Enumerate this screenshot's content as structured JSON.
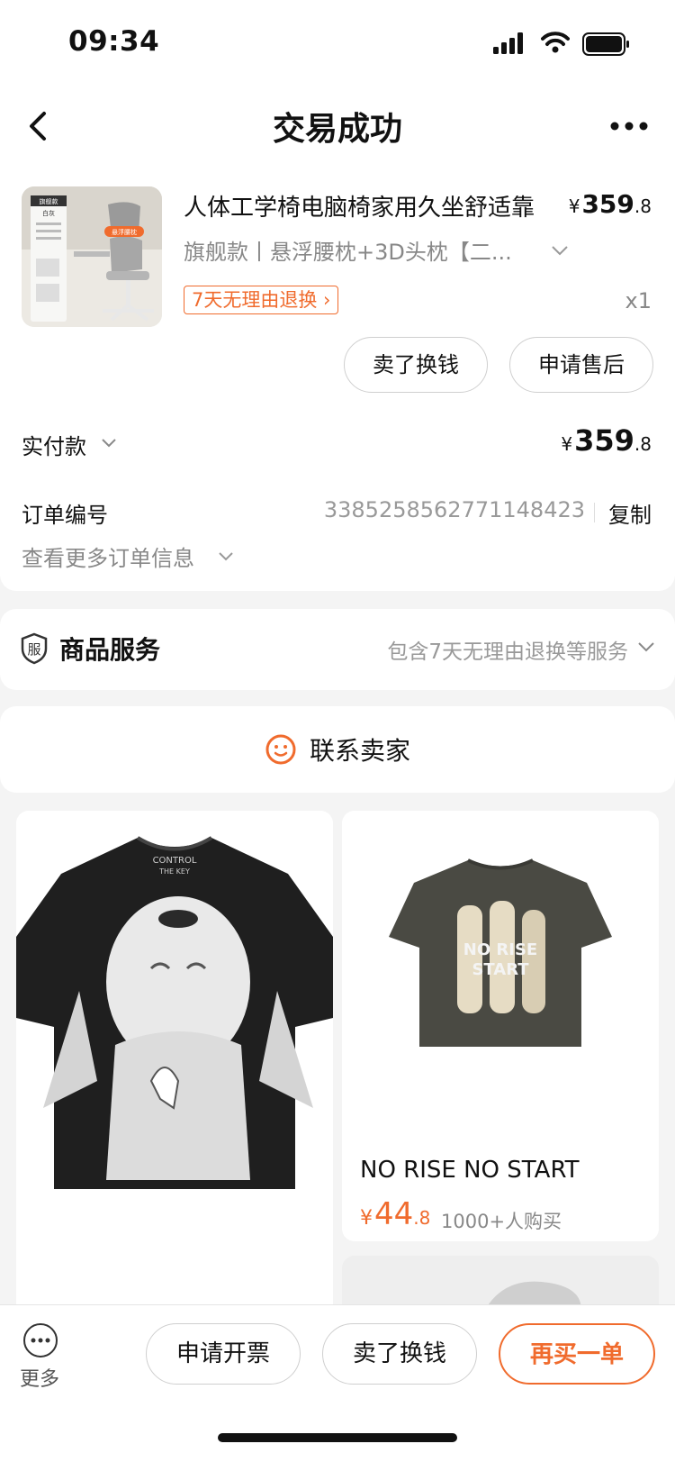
{
  "status_bar": {
    "time": "09:34"
  },
  "nav": {
    "title": "交易成功"
  },
  "order_item": {
    "name": "人体工学椅电脑椅家用久坐舒适靠",
    "price_int": "359",
    "price_dec": ".8",
    "currency": "¥",
    "spec": "旗舰款丨悬浮腰枕+3D头枕【二...",
    "tag": "7天无理由退换 ›",
    "qty": "x1",
    "thumb_texts": [
      "旗舰款",
      "白灰",
      "悬浮腰枕"
    ]
  },
  "actions": {
    "sell": "卖了换钱",
    "after_sale": "申请售后"
  },
  "payment": {
    "label": "实付款",
    "price_int": "359",
    "price_dec": ".8"
  },
  "order": {
    "label": "订单编号",
    "number": "3385258562771148423",
    "copy": "复制",
    "more_info": "查看更多订单信息"
  },
  "service": {
    "icon_char": "服",
    "title": "商品服务",
    "desc": "包含7天无理由退换等服务"
  },
  "contact": {
    "label": "联系卖家"
  },
  "recommend": {
    "left": {
      "shirt_text": [
        "CONTROL",
        "THE KEY"
      ]
    },
    "right": {
      "title": "NO RISE NO START",
      "price_int": "44",
      "price_dec": ".8",
      "sold": "1000+人购买",
      "shirt_text": [
        "NO RISE",
        "START"
      ]
    }
  },
  "bottom_bar": {
    "more": "更多",
    "invoice": "申请开票",
    "sell": "卖了换钱",
    "rebuy": "再买一单"
  },
  "colors": {
    "accent": "#f06b2d",
    "muted": "#888888"
  }
}
